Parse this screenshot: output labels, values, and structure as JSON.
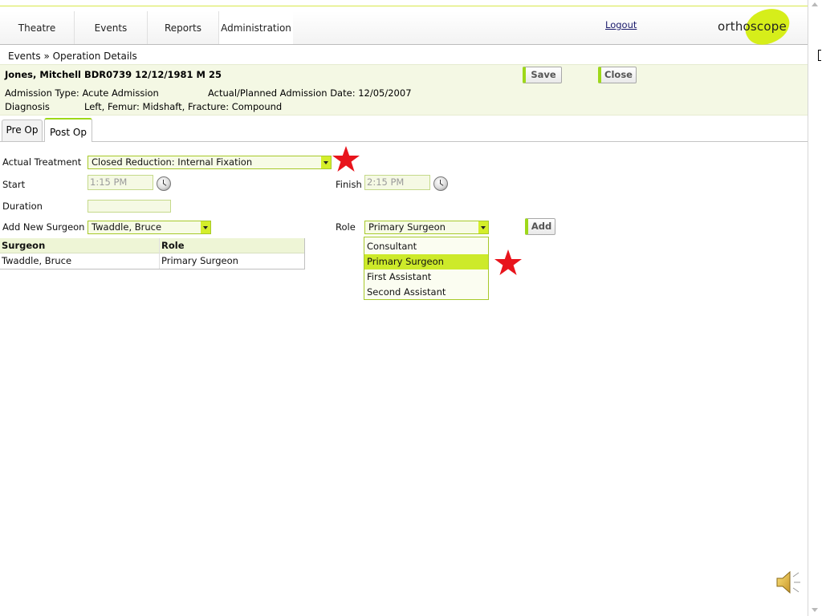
{
  "nav": {
    "tabs": [
      {
        "label": "Theatre"
      },
      {
        "label": "Events"
      },
      {
        "label": "Reports"
      },
      {
        "label": "Administration"
      }
    ],
    "logout": "Logout",
    "logo": "orthoscope"
  },
  "breadcrumb": "Events » Operation Details",
  "patient": {
    "name_line": "Jones, Mitchell BDR0739 12/12/1981 M 25",
    "admission_type": "Admission Type: Acute Admission",
    "admission_date": "Actual/Planned Admission Date: 12/05/2007",
    "diagnosis_label": "Diagnosis",
    "diagnosis_value": "Left, Femur: Midshaft, Fracture: Compound"
  },
  "buttons": {
    "save": "Save",
    "close": "Close",
    "add": "Add"
  },
  "subtabs": {
    "pre_op": "Pre Op",
    "post_op": "Post Op"
  },
  "form": {
    "treatment_label": "Actual Treatment",
    "treatment_value": "Closed Reduction: Internal Fixation",
    "start_label": "Start",
    "start_value": "1:15 PM",
    "finish_label": "Finish",
    "finish_value": "2:15 PM",
    "duration_label": "Duration",
    "duration_value": "",
    "add_surgeon_label": "Add New Surgeon",
    "add_surgeon_value": "Twaddle, Bruce",
    "role_label": "Role",
    "role_value": "Primary Surgeon",
    "role_options": [
      "Consultant",
      "Primary Surgeon",
      "First Assistant",
      "Second Assistant"
    ]
  },
  "surgeon_table": {
    "headers": [
      "Surgeon",
      "Role"
    ],
    "rows": [
      [
        "Twaddle, Bruce",
        "Primary Surgeon"
      ]
    ]
  },
  "colors": {
    "accent": "#cdea2a",
    "star": "#e8141c"
  },
  "icons": [
    "clock-icon",
    "star-icon",
    "speaker-icon",
    "dropdown-arrow-icon"
  ]
}
